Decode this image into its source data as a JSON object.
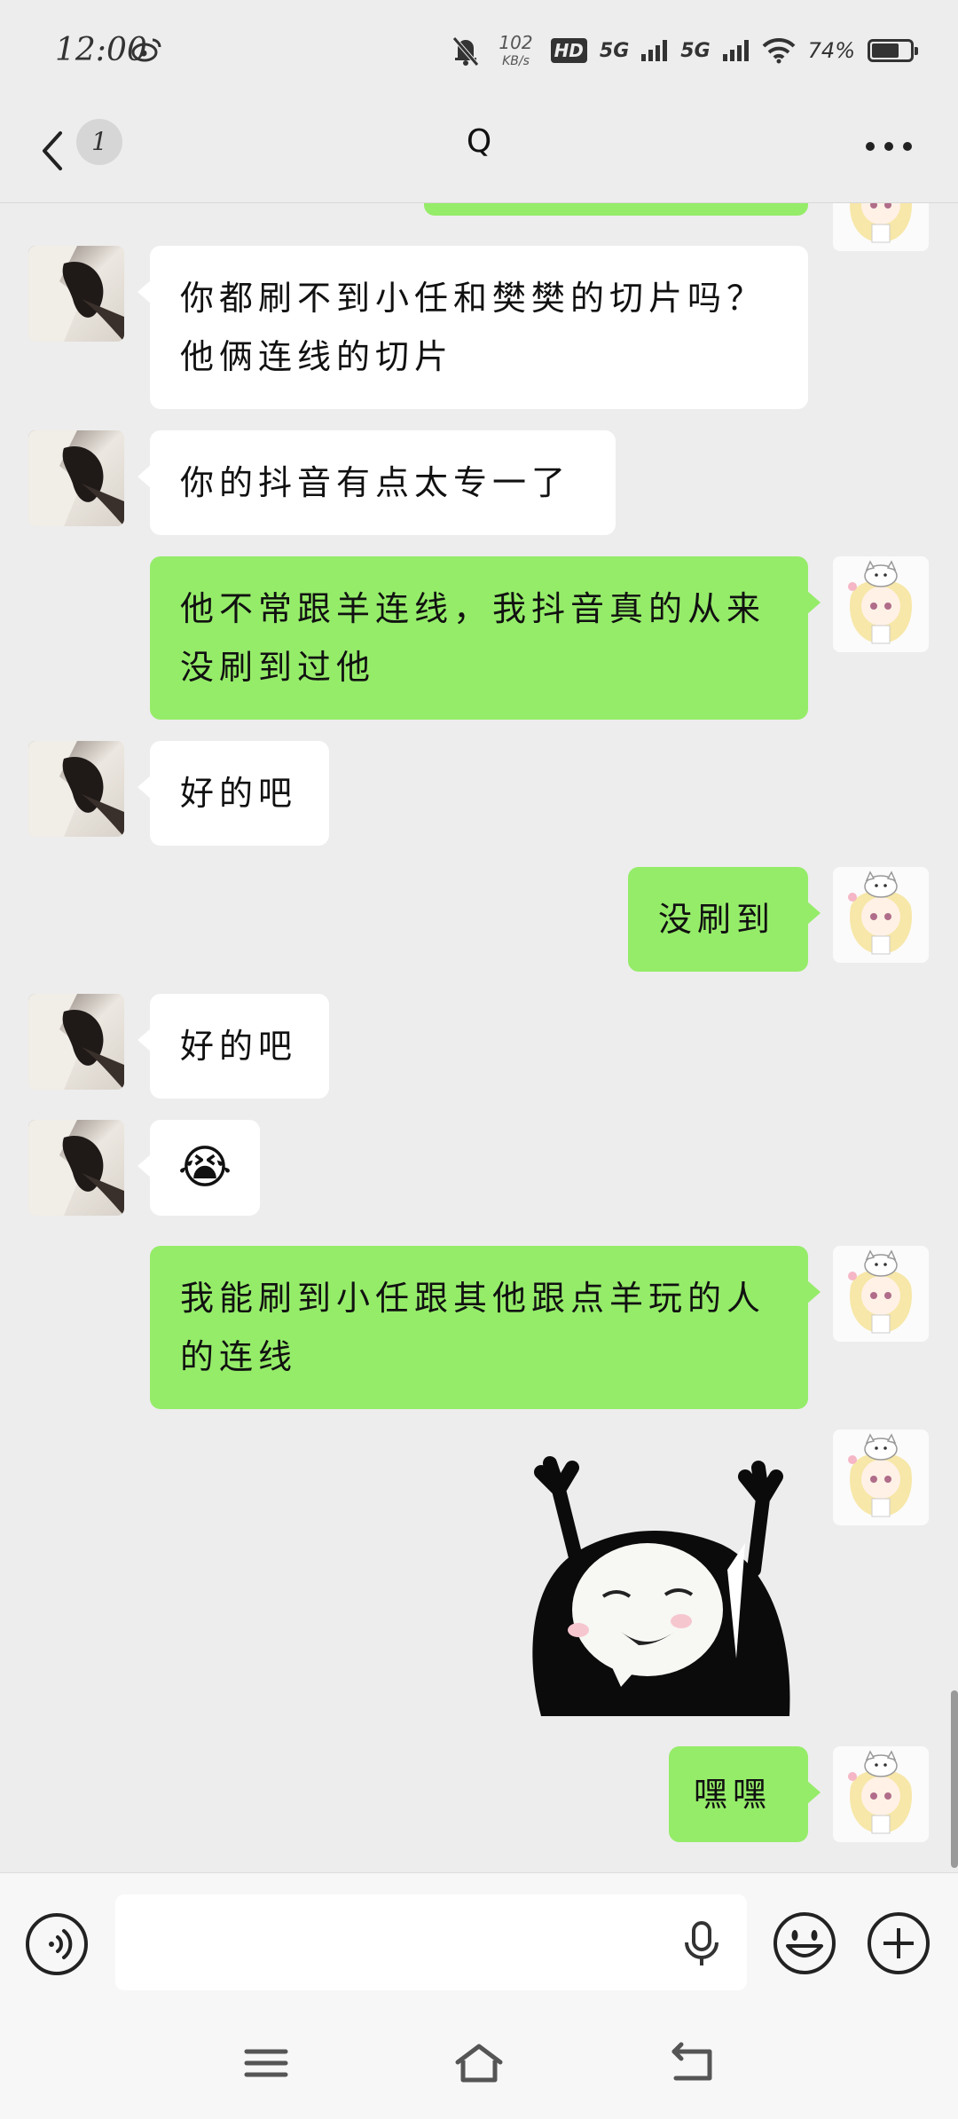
{
  "status_bar": {
    "time": "12:00",
    "net_speed_value": "102",
    "net_speed_unit": "KB/s",
    "hd_label": "HD",
    "signal1_label": "5G",
    "signal2_label": "5G",
    "battery": "74%",
    "battery_level": 0.74
  },
  "header": {
    "unread_count": "1",
    "title": "Q"
  },
  "messages": [
    {
      "side": "out",
      "text": ""
    },
    {
      "side": "in",
      "text": "你都刷不到小任和樊樊的切片吗？他俩连线的切片"
    },
    {
      "side": "in",
      "text": "你的抖音有点太专一了"
    },
    {
      "side": "out",
      "text": "他不常跟羊连线，我抖音真的从来没刷到过他"
    },
    {
      "side": "in",
      "text": "好的吧"
    },
    {
      "side": "out",
      "text": "没刷到"
    },
    {
      "side": "in",
      "text": "好的吧"
    },
    {
      "side": "in",
      "text": "😭"
    },
    {
      "side": "out",
      "text": "我能刷到小任跟其他跟点羊玩的人的连线"
    },
    {
      "side": "out",
      "sticker": "arms-up-meme-sticker"
    },
    {
      "side": "out",
      "text": "嘿嘿"
    }
  ],
  "input": {
    "value": "",
    "placeholder": ""
  },
  "colors": {
    "background": "#ededed",
    "incoming_bubble": "#ffffff",
    "outgoing_bubble": "#95ec69"
  },
  "icons": [
    "weibo-icon",
    "mute-icon",
    "wifi-icon",
    "back-icon",
    "more-icon",
    "voice-icon",
    "mic-icon",
    "emoji-icon",
    "plus-icon",
    "menu-icon",
    "home-icon",
    "return-icon"
  ]
}
